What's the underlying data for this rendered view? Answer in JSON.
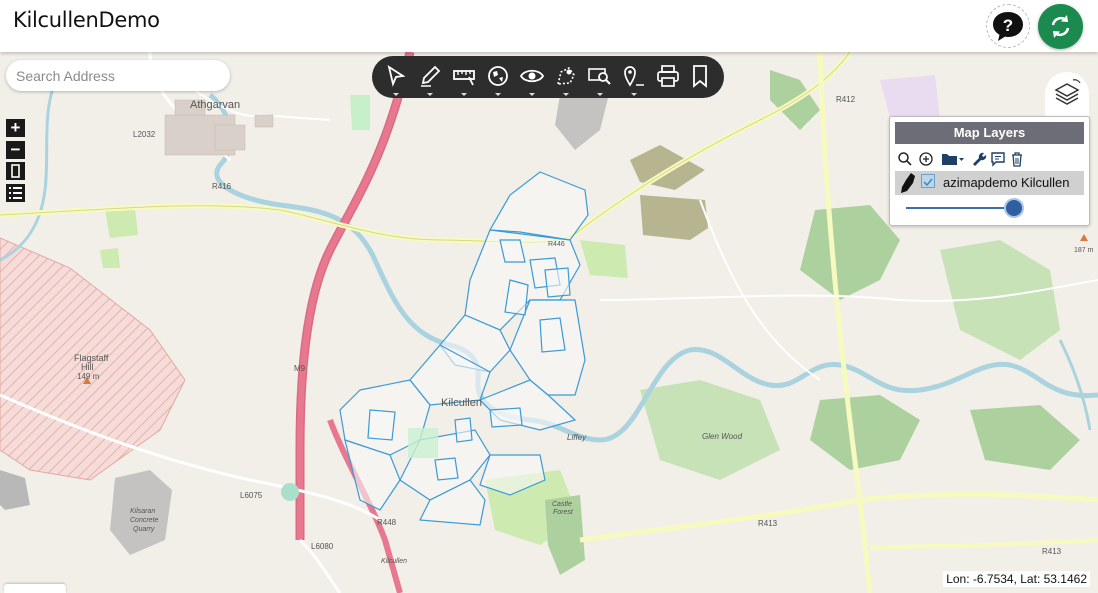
{
  "header": {
    "title": "KilcullenDemo"
  },
  "search": {
    "placeholder": "Search Address"
  },
  "toolbar": {
    "tools": [
      "select-icon",
      "draw-icon",
      "measure-icon",
      "globe-icon",
      "visibility-icon",
      "route-icon",
      "find-icon",
      "marker-icon",
      "print-icon",
      "bookmark-icon"
    ]
  },
  "zoom_controls": {
    "in": "+",
    "out": "−"
  },
  "layers_panel": {
    "title": "Map Layers",
    "layers": [
      {
        "name": "azimapdemo Kilcullen",
        "checked": true,
        "opacity": 0.92
      }
    ]
  },
  "status": {
    "coords": "Lon: -6.7534, Lat: 53.1462"
  },
  "map_labels": {
    "athgarvan": "Athgarvan",
    "l2032": "L2032",
    "r416": "R416",
    "r412": "R412",
    "flagstaff": "Flagstaff",
    "hill": "Hill",
    "hill_elev": "149 m",
    "m9": "M9",
    "kilcullen": "Kilcullen",
    "glen_wood": "Glen Wood",
    "liffey": "Liffey",
    "l6075": "L6075",
    "l6080": "L6080",
    "r448": "R448",
    "r413a": "R413",
    "r413b": "R413",
    "kilsaran": "Kilsaran",
    "concrete": "Concrete",
    "quarry": "Quarry",
    "elev187": "187 m",
    "castle": "Castle",
    "forest": "Forest",
    "kilcullen_south": "Kilcullen",
    "r446": "R446"
  },
  "colors": {
    "accent_green": "#1a8a4f",
    "toolbar_bg": "#2d2d2d",
    "parcel_line": "#3a9bd5",
    "motorway": "#e8788f"
  }
}
